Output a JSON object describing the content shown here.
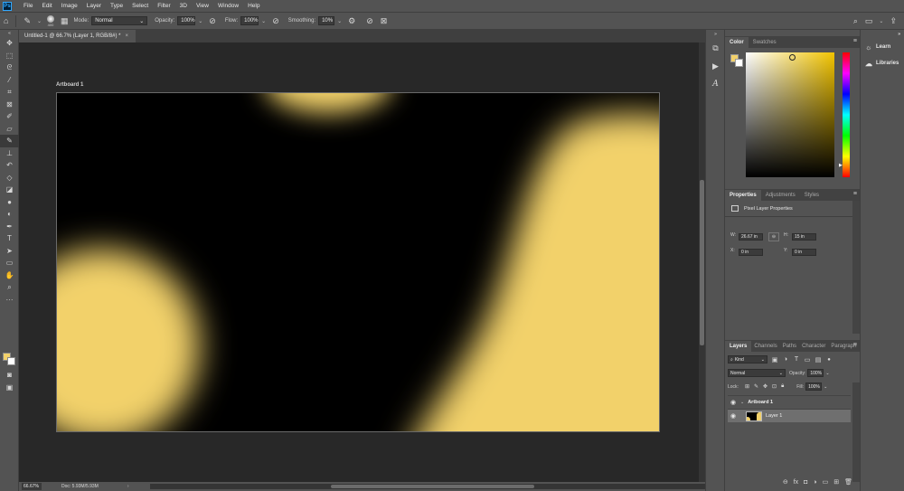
{
  "menubar": {
    "app_logo": "Ps",
    "items": [
      "File",
      "Edit",
      "Image",
      "Layer",
      "Type",
      "Select",
      "Filter",
      "3D",
      "View",
      "Window",
      "Help"
    ]
  },
  "options": {
    "brush_size": "400",
    "mode_label": "Mode:",
    "mode_value": "Normal",
    "opacity_label": "Opacity:",
    "opacity_value": "100%",
    "flow_label": "Flow:",
    "flow_value": "100%",
    "smoothing_label": "Smoothing:",
    "smoothing_value": "10%"
  },
  "document": {
    "tab_title": "Untitled-1 @ 66.7% (Layer 1, RGB/8#) *",
    "tab_close": "×",
    "artboard_label": "Artboard 1"
  },
  "statusbar": {
    "zoom": "66.67%",
    "doc_info": "Doc: 5.93M/5.93M"
  },
  "color_panel": {
    "tabs": [
      "Color",
      "Swatches"
    ],
    "foreground": "#f2d16b",
    "background": "#ffffff",
    "hue_color": "#f2c400"
  },
  "properties_panel": {
    "tabs": [
      "Properties",
      "Adjustments",
      "Styles"
    ],
    "type_label": "Pixel Layer Properties",
    "w_label": "W:",
    "w_value": "26.67 in",
    "h_label": "H:",
    "h_value": "15 in",
    "x_label": "X:",
    "x_value": "0 in",
    "y_label": "Y:",
    "y_value": "0 in"
  },
  "layers_panel": {
    "tabs": [
      "Layers",
      "Channels",
      "Paths",
      "Character",
      "Paragraph"
    ],
    "kind_value": "Kind",
    "blend_value": "Normal",
    "opacity_label": "Opacity:",
    "opacity_value": "100%",
    "lock_label": "Lock:",
    "fill_label": "Fill:",
    "fill_value": "100%",
    "artboard_name": "Artboard 1",
    "layer_name": "Layer 1"
  },
  "right_dock": {
    "items": [
      "Learn",
      "Libraries"
    ]
  },
  "canvas": {
    "paint_color": "#f2d16b",
    "background_color": "#000000"
  }
}
